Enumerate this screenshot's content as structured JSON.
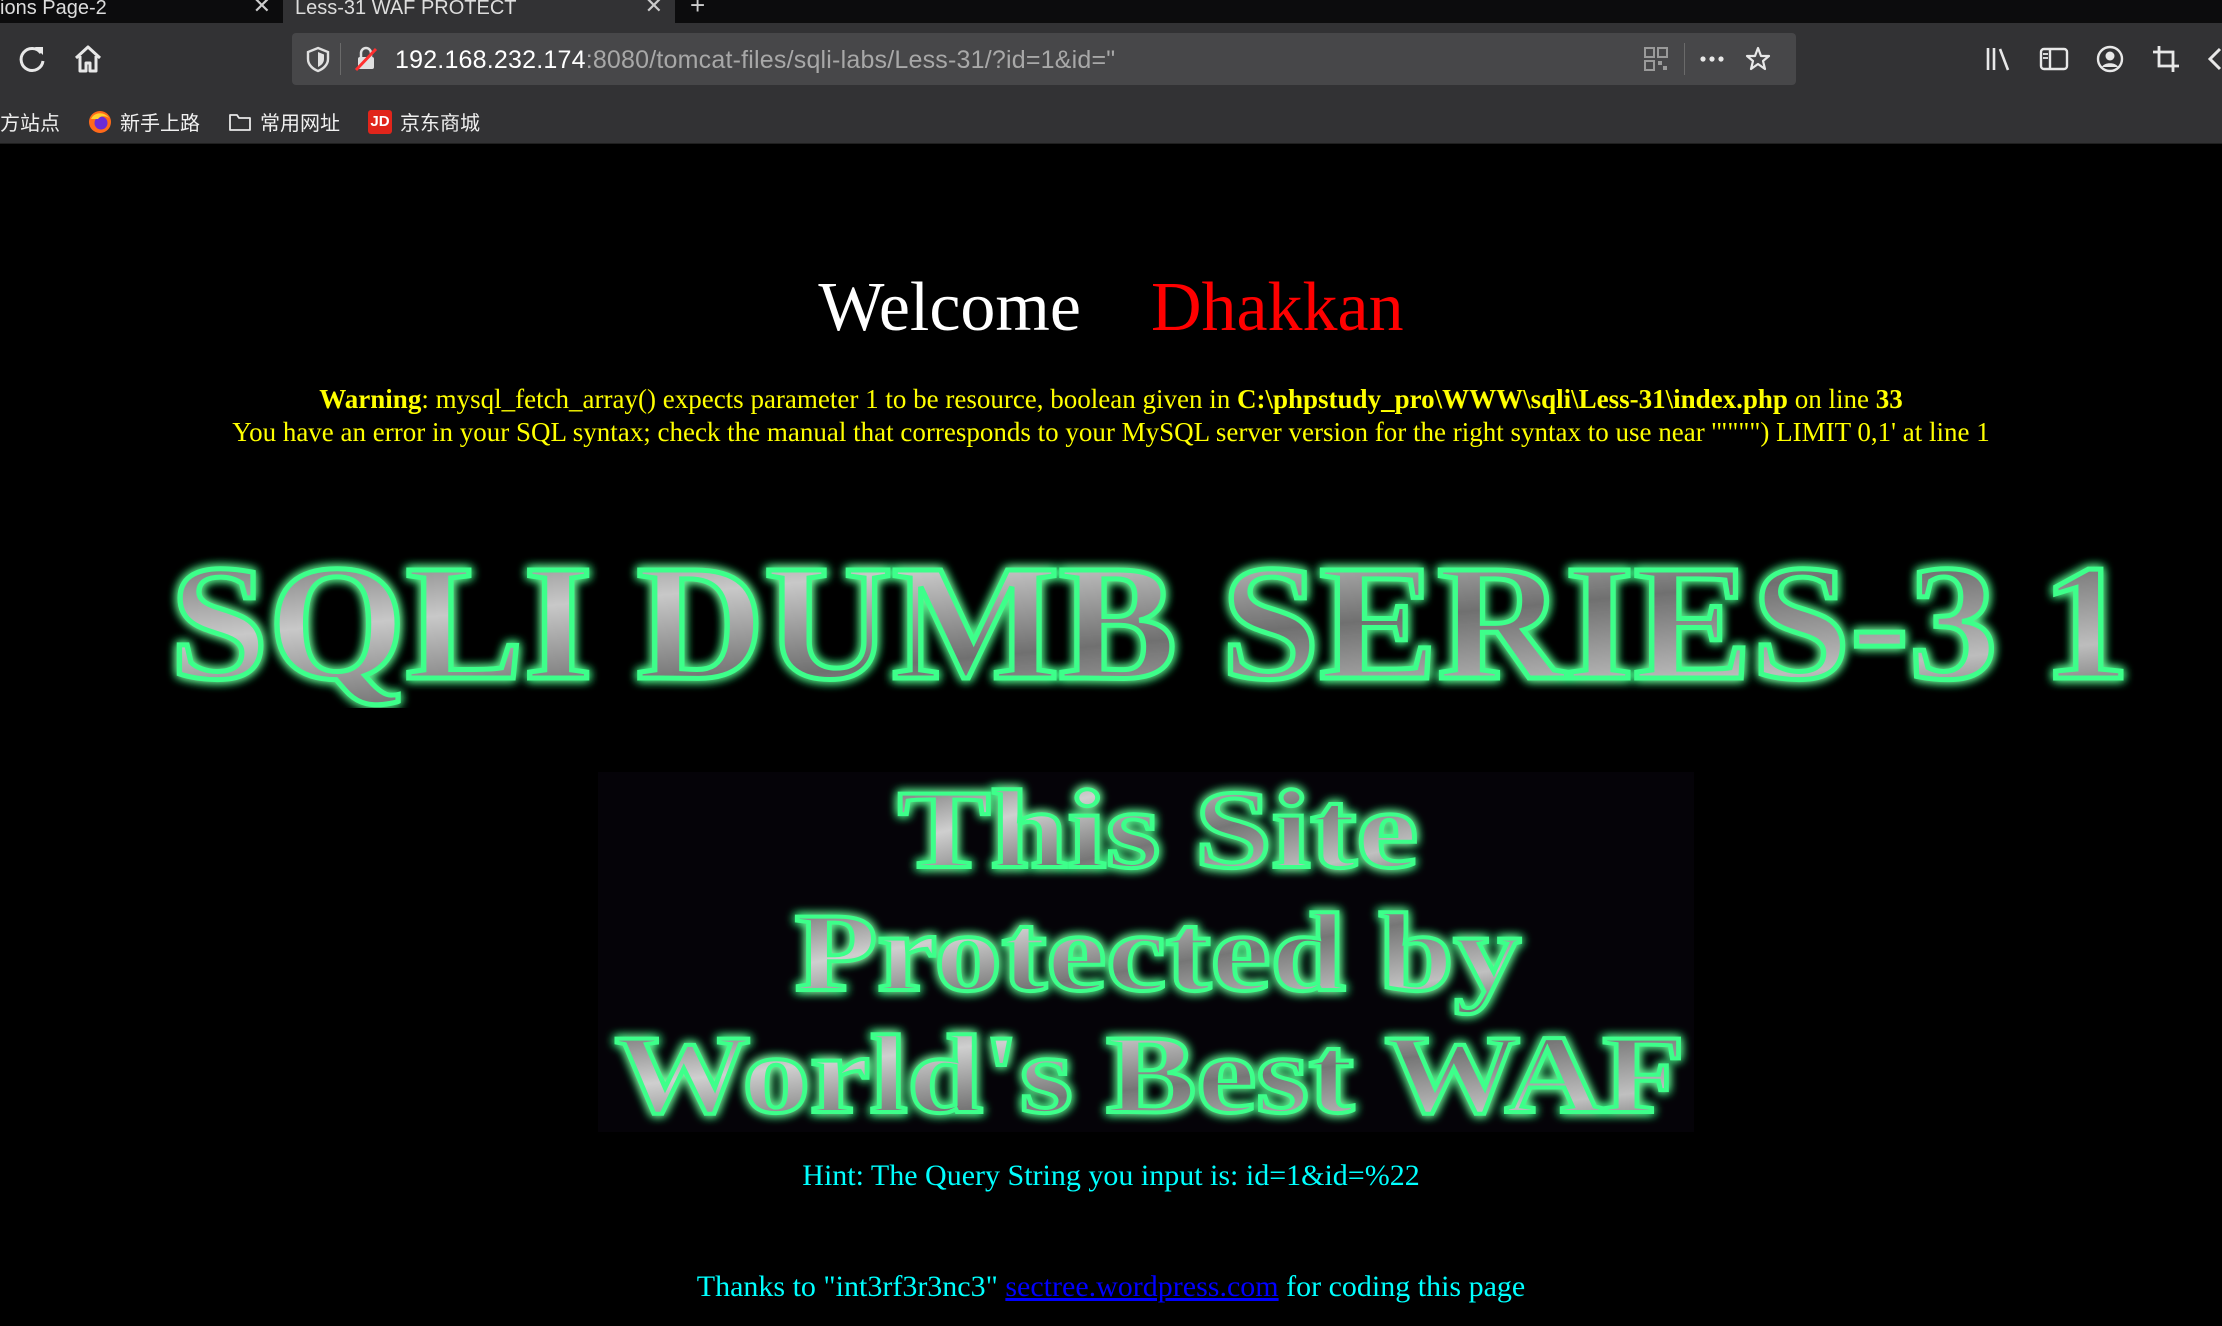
{
  "tabs": [
    {
      "title": "ions Page-2",
      "close": "✕"
    },
    {
      "title": "Less-31 WAF PROTECT",
      "close": "✕"
    }
  ],
  "new_tab": "+",
  "address_bar": {
    "host": "192.168.232.174",
    "rest": ":8080/tomcat-files/sqli-labs/Less-31/?id=1&id=\""
  },
  "bookmarks": [
    {
      "label": "方站点",
      "icon": "none"
    },
    {
      "label": "新手上路",
      "icon": "firefox-icon"
    },
    {
      "label": "常用网址",
      "icon": "folder-icon"
    },
    {
      "label": "京东商城",
      "icon": "jd-icon"
    }
  ],
  "jd_icon_text": "JD",
  "page": {
    "welcome": "Welcome",
    "name": "Dhakkan",
    "warning_label": "Warning",
    "warning_text": ": mysql_fetch_array() expects parameter 1 to be resource, boolean given in ",
    "warning_path": "C:\\phpstudy_pro\\WWW\\sqli\\Less-31\\index.php",
    "warning_online": " on line ",
    "warning_line": "33",
    "sql_error": "You have an error in your SQL syntax; check the manual that corresponds to your MySQL server version for the right syntax to use near '\"\"\"\") LIMIT 0,1' at line 1",
    "banner_text": "SQLI DUMB SERIES-3 1",
    "waf_lines": [
      "This Site",
      "Protected by",
      "World's Best WAF"
    ],
    "hint": "Hint: The Query String you input is: id=1&id=%22",
    "thanks_prefix": "Thanks to \"int3rf3r3nc3\" ",
    "thanks_link": "sectree.wordpress.com",
    "thanks_suffix": " for coding this page"
  },
  "colors": {
    "background": "#000000",
    "welcome": "#ffffff",
    "name": "#ff0000",
    "error": "#ffff00",
    "hint": "#00ffff",
    "link": "#0000ff",
    "glow": "#00ff66"
  }
}
